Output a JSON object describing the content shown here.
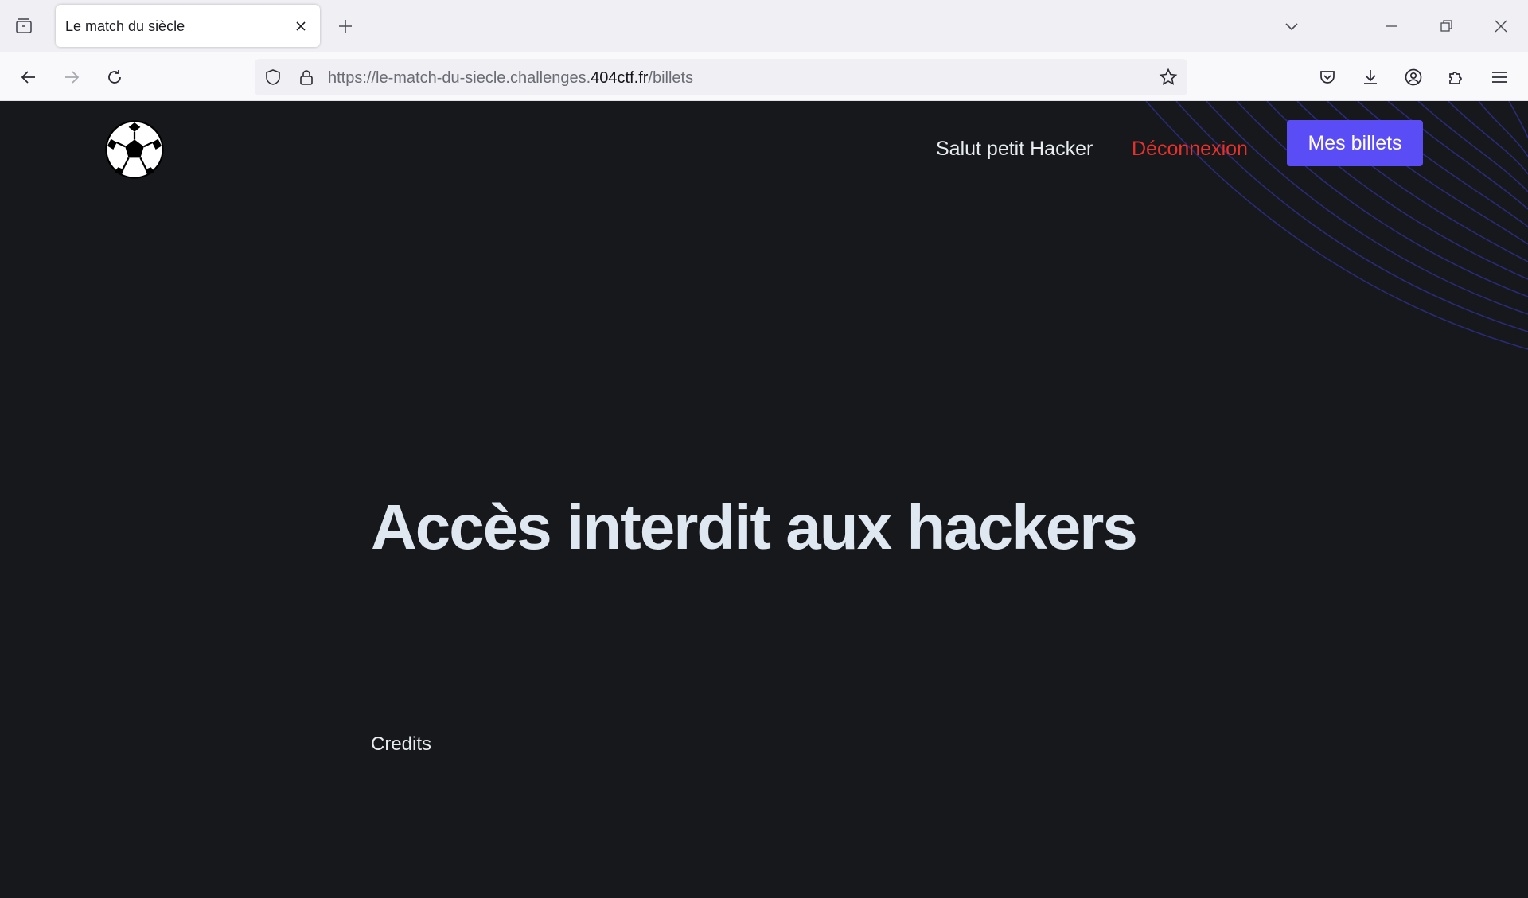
{
  "browser": {
    "tab_title": "Le match du siècle",
    "url": {
      "prefix": "https://le-match-du-siecle.challenges.",
      "host_strong": "404ctf.fr",
      "path": "/billets"
    },
    "icons": {
      "tab_list": "tab-list-icon",
      "close_tab": "close-icon",
      "new_tab": "plus-icon",
      "list_all_tabs": "chevron-down-icon",
      "minimize": "minimize-icon",
      "restore": "restore-icon",
      "close_window": "close-icon",
      "back": "back-arrow-icon",
      "forward": "forward-arrow-icon",
      "reload": "reload-icon",
      "tracking_protection": "shield-icon",
      "secure": "lock-icon",
      "bookmark": "star-icon",
      "pocket": "pocket-icon",
      "downloads": "download-icon",
      "account": "account-icon",
      "extensions": "puzzle-icon",
      "menu": "hamburger-menu-icon"
    }
  },
  "header": {
    "logo": "soccer-ball-icon",
    "greeting": "Salut petit Hacker",
    "logout_label": "Déconnexion",
    "tickets_label": "Mes billets"
  },
  "main": {
    "headline": "Accès interdit aux hackers",
    "credits_label": "Credits"
  },
  "colors": {
    "page_bg": "#16181b",
    "accent_button": "#5b4df5",
    "logout_red": "#e8302c",
    "headline": "#dfe8f0",
    "wave_lines": "#2b2a78"
  }
}
